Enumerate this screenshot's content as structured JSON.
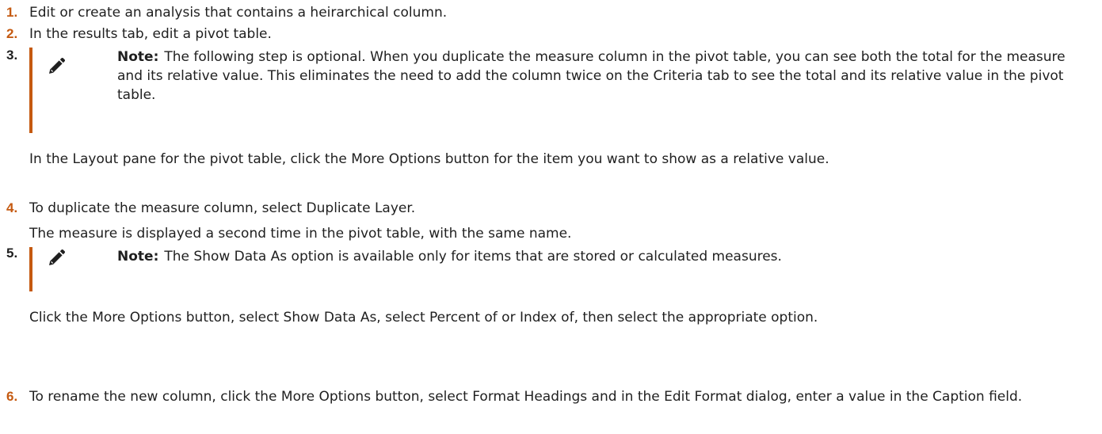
{
  "steps": [
    {
      "number": "1.",
      "text": "Edit or create an analysis that contains a heirarchical column."
    },
    {
      "number": "2.",
      "text": "In the results tab, edit a pivot table."
    },
    {
      "number": "3.",
      "note_label": "Note:",
      "note_text": "The following step is optional. When you duplicate the measure column in the pivot table, you can see both the total for the measure and its relative value. This eliminates the need to add the column twice on the Criteria tab to see the total and its relative value in the pivot table.",
      "text": "In the Layout pane for the pivot table, click the More Options button for the item you want to show as a relative value."
    },
    {
      "number": "4.",
      "text": "To duplicate the measure column, select Duplicate Layer.",
      "result": "The measure is displayed a second time in the pivot table, with the same name."
    },
    {
      "number": "5.",
      "note_label": "Note:",
      "note_text": "The Show Data As option is available only for items that are stored or calculated measures.",
      "text": "Click the More Options button, select Show Data As, select Percent of or Index of, then select the appropriate option."
    },
    {
      "number": "6.",
      "text": "To rename the new column, click the More Options button, select Format Headings and in the Edit Format dialog, enter a value in the Caption field."
    }
  ],
  "icons": {
    "note_icon": "pencil-icon"
  },
  "colors": {
    "accent": "#c55a11",
    "text": "#1f1f1f"
  }
}
